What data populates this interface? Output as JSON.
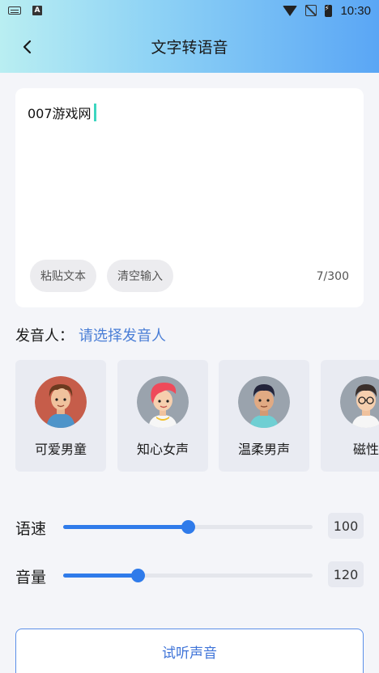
{
  "status_bar": {
    "time": "10:30",
    "left_icons": [
      "keyboard-icon",
      "a-icon"
    ],
    "right_icons": [
      "wifi-icon",
      "no-signal-icon",
      "battery-charging-icon"
    ]
  },
  "header": {
    "title": "文字转语音",
    "back_icon": "chevron-left-icon"
  },
  "editor": {
    "text": "007游戏网",
    "paste_label": "粘贴文本",
    "clear_label": "清空输入",
    "counter": "7/300"
  },
  "speaker": {
    "label": "发音人：",
    "select_label": "请选择发音人"
  },
  "voices": [
    {
      "name": "可爱男童",
      "avatar": "boy-avatar-icon"
    },
    {
      "name": "知心女声",
      "avatar": "girl-avatar-icon"
    },
    {
      "name": "温柔男声",
      "avatar": "man-avatar-icon"
    },
    {
      "name": "磁性",
      "avatar": "glasses-man-avatar-icon"
    }
  ],
  "sliders": {
    "speed": {
      "label": "语速",
      "value": "100",
      "fill_fraction": 0.5
    },
    "volume": {
      "label": "音量",
      "value": "120",
      "fill_fraction": 0.3
    }
  },
  "listen_button": "试听声音",
  "colors": {
    "accent": "#2f7bea",
    "link": "#4a7ed6",
    "caret": "#3dd6c0"
  }
}
